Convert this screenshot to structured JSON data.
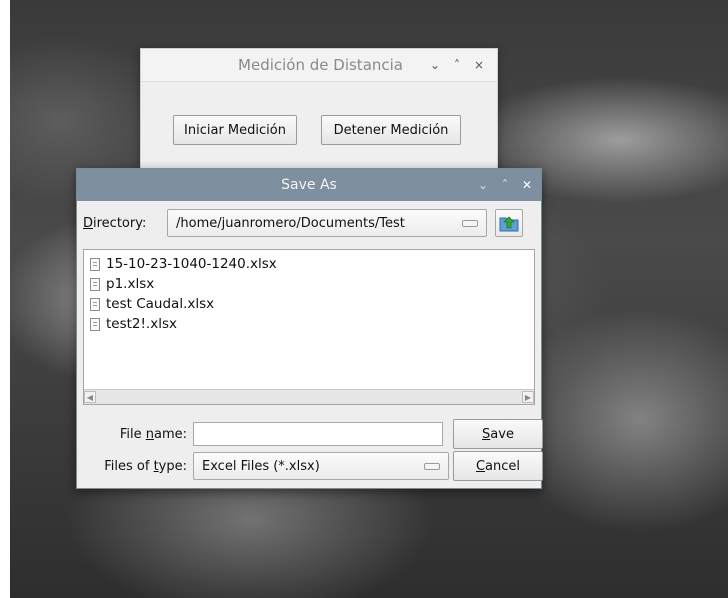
{
  "background_window": {
    "title": "Medición de Distancia",
    "btn_start": "Iniciar Medición",
    "btn_stop": "Detener Medición",
    "controls": {
      "minimize": "⌄",
      "maximize": "˄",
      "close": "×"
    }
  },
  "dialog": {
    "title": "Save As",
    "controls": {
      "minimize": "⌄",
      "maximize": "˄",
      "close": "✕"
    },
    "directory_label_mnemonic": "D",
    "directory_label_rest": "irectory:",
    "directory_value": "/home/juanromero/Documents/Test",
    "files": [
      {
        "name": "15-10-23-1040-1240.xlsx"
      },
      {
        "name": "p1.xlsx"
      },
      {
        "name": "test Caudal.xlsx"
      },
      {
        "name": "test2!.xlsx"
      }
    ],
    "filename_label_pre": "File ",
    "filename_label_mnemonic": "n",
    "filename_label_post": "ame:",
    "filename_value": "",
    "filetype_label_pre": "Files of ",
    "filetype_label_mnemonic": "t",
    "filetype_label_post": "ype:",
    "filetype_value": "Excel Files (*.xlsx)",
    "save_mnemonic": "S",
    "save_rest": "ave",
    "cancel_mnemonic": "C",
    "cancel_rest": "ancel"
  },
  "colors": {
    "dialog_titlebar": "#7e8fa0",
    "up_icon_green": "#3aa23a",
    "up_icon_folder": "#5f9ed6"
  }
}
